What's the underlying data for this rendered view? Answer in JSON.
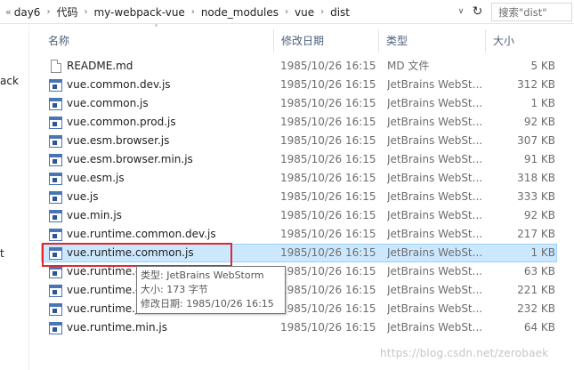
{
  "address_bar": {
    "overflow": "«",
    "breadcrumbs": [
      "day6",
      "代码",
      "my-webpack-vue",
      "node_modules",
      "vue",
      "dist"
    ],
    "search_placeholder": "搜索\"dist\""
  },
  "nav_fragments": [
    "ack",
    "t"
  ],
  "columns": {
    "name": "名称",
    "date": "修改日期",
    "type": "类型",
    "size": "大小"
  },
  "files": [
    {
      "name": "README.md",
      "date": "1985/10/26 16:15",
      "type": "MD 文件",
      "size": "5 KB",
      "icon": "document-icon"
    },
    {
      "name": "vue.common.dev.js",
      "date": "1985/10/26 16:15",
      "type": "JetBrains WebSt...",
      "size": "312 KB",
      "icon": "webstorm-js-icon"
    },
    {
      "name": "vue.common.js",
      "date": "1985/10/26 16:15",
      "type": "JetBrains WebSt...",
      "size": "1 KB",
      "icon": "webstorm-js-icon"
    },
    {
      "name": "vue.common.prod.js",
      "date": "1985/10/26 16:15",
      "type": "JetBrains WebSt...",
      "size": "92 KB",
      "icon": "webstorm-js-icon"
    },
    {
      "name": "vue.esm.browser.js",
      "date": "1985/10/26 16:15",
      "type": "JetBrains WebSt...",
      "size": "307 KB",
      "icon": "webstorm-js-icon"
    },
    {
      "name": "vue.esm.browser.min.js",
      "date": "1985/10/26 16:15",
      "type": "JetBrains WebSt...",
      "size": "91 KB",
      "icon": "webstorm-js-icon"
    },
    {
      "name": "vue.esm.js",
      "date": "1985/10/26 16:15",
      "type": "JetBrains WebSt...",
      "size": "318 KB",
      "icon": "webstorm-js-icon"
    },
    {
      "name": "vue.js",
      "date": "1985/10/26 16:15",
      "type": "JetBrains WebSt...",
      "size": "333 KB",
      "icon": "webstorm-js-icon"
    },
    {
      "name": "vue.min.js",
      "date": "1985/10/26 16:15",
      "type": "JetBrains WebSt...",
      "size": "92 KB",
      "icon": "webstorm-js-icon"
    },
    {
      "name": "vue.runtime.common.dev.js",
      "date": "1985/10/26 16:15",
      "type": "JetBrains WebSt...",
      "size": "217 KB",
      "icon": "webstorm-js-icon"
    },
    {
      "name": "vue.runtime.common.js",
      "date": "1985/10/26 16:15",
      "type": "JetBrains WebSt...",
      "size": "1 KB",
      "icon": "webstorm-js-icon",
      "selected": true
    },
    {
      "name": "vue.runtime.c",
      "date": "1985/10/26 16:15",
      "type": "JetBrains WebSt...",
      "size": "63 KB",
      "icon": "webstorm-js-icon"
    },
    {
      "name": "vue.runtime.e",
      "date": "1985/10/26 16:15",
      "type": "JetBrains WebSt...",
      "size": "221 KB",
      "icon": "webstorm-js-icon"
    },
    {
      "name": "vue.runtime.js",
      "date": "1985/10/26 16:15",
      "type": "JetBrains WebSt...",
      "size": "232 KB",
      "icon": "webstorm-js-icon"
    },
    {
      "name": "vue.runtime.min.js",
      "date": "1985/10/26 16:15",
      "type": "JetBrains WebSt...",
      "size": "64 KB",
      "icon": "webstorm-js-icon"
    }
  ],
  "tooltip": {
    "type_line": "类型: JetBrains WebStorm",
    "size_line": "大小: 173 字节",
    "date_line": "修改日期: 1985/10/26 16:15"
  },
  "watermark": "https://blog.csdn.net/zerobaek"
}
